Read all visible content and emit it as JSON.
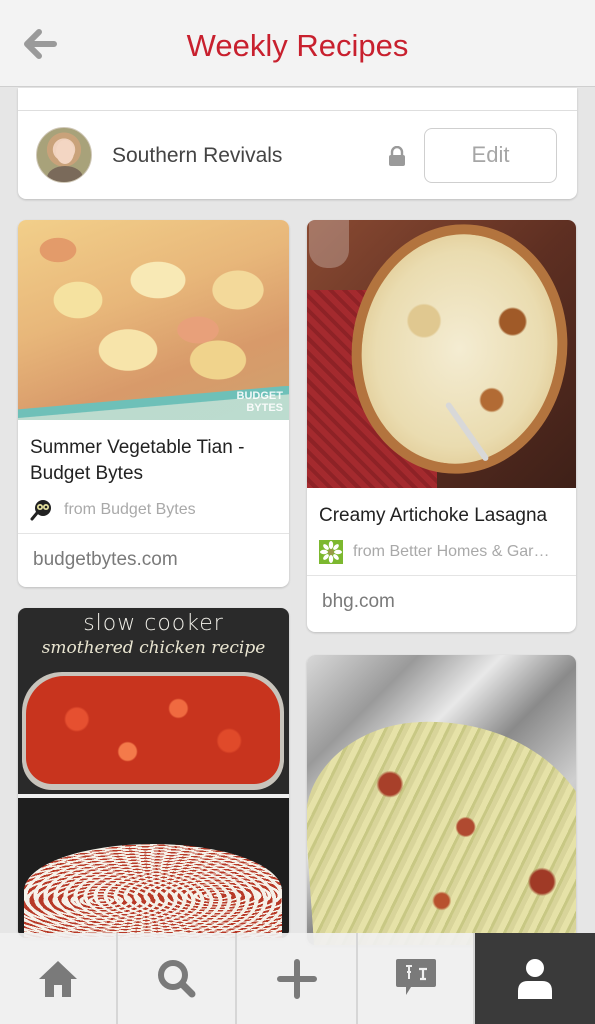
{
  "header": {
    "title": "Weekly Recipes",
    "back_icon": "arrow-left-icon",
    "title_color": "#c8202e"
  },
  "board": {
    "owner_name": "Southern Revivals",
    "privacy_icon": "lock-icon",
    "edit_label": "Edit"
  },
  "pins": [
    {
      "image_alt": "Summer vegetable tian in a glass baking dish",
      "image_watermark": "BUDGET BYTES",
      "description": "Summer Vegetable Tian - Budget Bytes",
      "source": "from Budget Bytes",
      "source_icon": "budget-bytes-logo-icon",
      "domain": "budgetbytes.com"
    },
    {
      "image_alt": "Creamy artichoke lasagna in an oval dish",
      "description": "Creamy Artichoke Lasagna",
      "source": "from Better Homes & Gar…",
      "source_icon": "bhg-daisy-logo-icon",
      "domain": "bhg.com"
    },
    {
      "image_alt": "Slow cooker smothered chicken recipe",
      "image_text_line1": "slow cooker",
      "image_text_line2": "smothered chicken recipe"
    },
    {
      "image_alt": "Roasted cabbage wedge with bacon on foil"
    }
  ],
  "tabbar": {
    "tabs": [
      {
        "name": "home",
        "icon": "home-icon",
        "active": false
      },
      {
        "name": "search",
        "icon": "search-icon",
        "active": false
      },
      {
        "name": "add",
        "icon": "plus-icon",
        "active": false
      },
      {
        "name": "notifications",
        "icon": "pin-speech-bubble-icon",
        "active": false
      },
      {
        "name": "profile",
        "icon": "person-icon",
        "active": true
      }
    ]
  }
}
